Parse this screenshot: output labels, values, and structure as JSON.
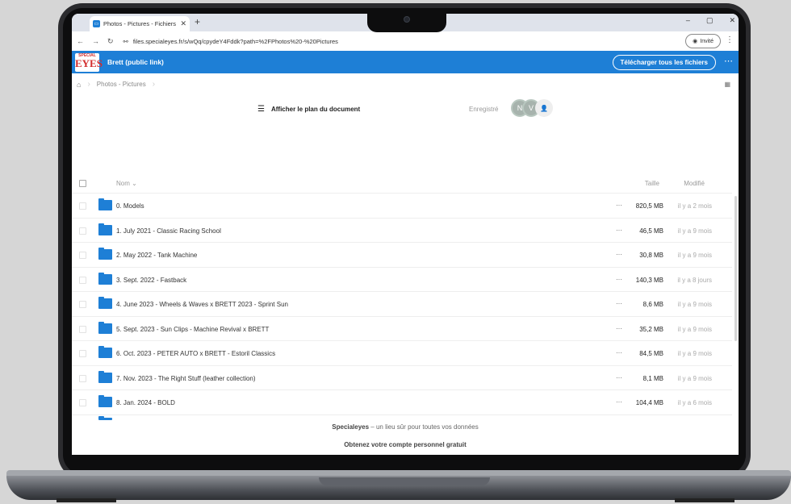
{
  "browser": {
    "tab_title": "Photos - Pictures - Fichiers - Sp",
    "tab_favicon": "specialeyes-favicon-icon",
    "url": "files.specialeyes.fr/s/wQq/cpydeY4Fddk?path=%2FPhotos%20-%20Pictures",
    "guest_label": "Invité"
  },
  "app": {
    "logo_top": "SPECIAL",
    "logo_main": "EYES",
    "title": "Brett (public link)",
    "download_all": "Télécharger tous les fichiers",
    "accent_color": "#1e7fd6"
  },
  "breadcrumb": {
    "current": "Photos - Pictures"
  },
  "document": {
    "plan_label": "Afficher le plan du document",
    "saved_label": "Enregistré",
    "avatars": [
      "N",
      "V"
    ]
  },
  "table": {
    "headers": {
      "name": "Nom",
      "size": "Taille",
      "modified": "Modifié"
    },
    "rows": [
      {
        "name": "0. Models",
        "size": "820,5 MB",
        "modified": "il y a 2 mois"
      },
      {
        "name": "1. July 2021 - Classic Racing School",
        "size": "46,5 MB",
        "modified": "il y a 9 mois"
      },
      {
        "name": "2. May 2022 - Tank Machine",
        "size": "30,8 MB",
        "modified": "il y a 9 mois"
      },
      {
        "name": "3. Sept. 2022 - Fastback",
        "size": "140,3 MB",
        "modified": "il y a 8 jours"
      },
      {
        "name": "4. June 2023 - Wheels & Waves x BRETT 2023 - Sprint Sun",
        "size": "8,6 MB",
        "modified": "il y a 9 mois"
      },
      {
        "name": "5. Sept. 2023 - Sun Clips - Machine Revival x BRETT",
        "size": "35,2 MB",
        "modified": "il y a 9 mois"
      },
      {
        "name": "6. Oct. 2023 - PETER AUTO x BRETT - Estoril Classics",
        "size": "84,5 MB",
        "modified": "il y a 9 mois"
      },
      {
        "name": "7. Nov. 2023 - The Right Stuff (leather collection)",
        "size": "8,1 MB",
        "modified": "il y a 9 mois"
      },
      {
        "name": "8. Jan. 2024 - BOLD",
        "size": "104,4 MB",
        "modified": "il y a 6 mois"
      }
    ]
  },
  "footer": {
    "brand": "Specialeyes",
    "tagline": " – un lieu sûr pour toutes vos données",
    "cta": "Obtenez votre compte personnel gratuit"
  }
}
